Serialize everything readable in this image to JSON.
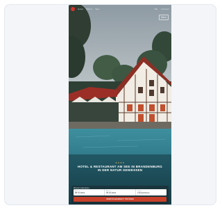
{
  "brand": {
    "accent": "#d6322c",
    "cta_color": "#c8412a"
  },
  "topbar": {
    "logo_text": "L",
    "nav": [
      "Hotel",
      "Offers",
      "Spa"
    ],
    "right": [
      "DE",
      "Contact"
    ]
  },
  "menu_label": "Menu",
  "hero": {
    "stars": "★★★★",
    "headline": "HOTEL & RESTAURANT AM SEE IN BRANDENBURG IN DER NATUR GENIESSEN"
  },
  "booking": {
    "label": "Zimmer reservieren",
    "fields": [
      {
        "label": "Anreise",
        "value": "08.10.2024"
      },
      {
        "label": "Abreise",
        "value": "09.10.2024"
      },
      {
        "label": "Gäste",
        "value": "2 Erwachsene"
      }
    ],
    "cta_label": "VERFÜGBARKEIT PRÜFEN"
  }
}
